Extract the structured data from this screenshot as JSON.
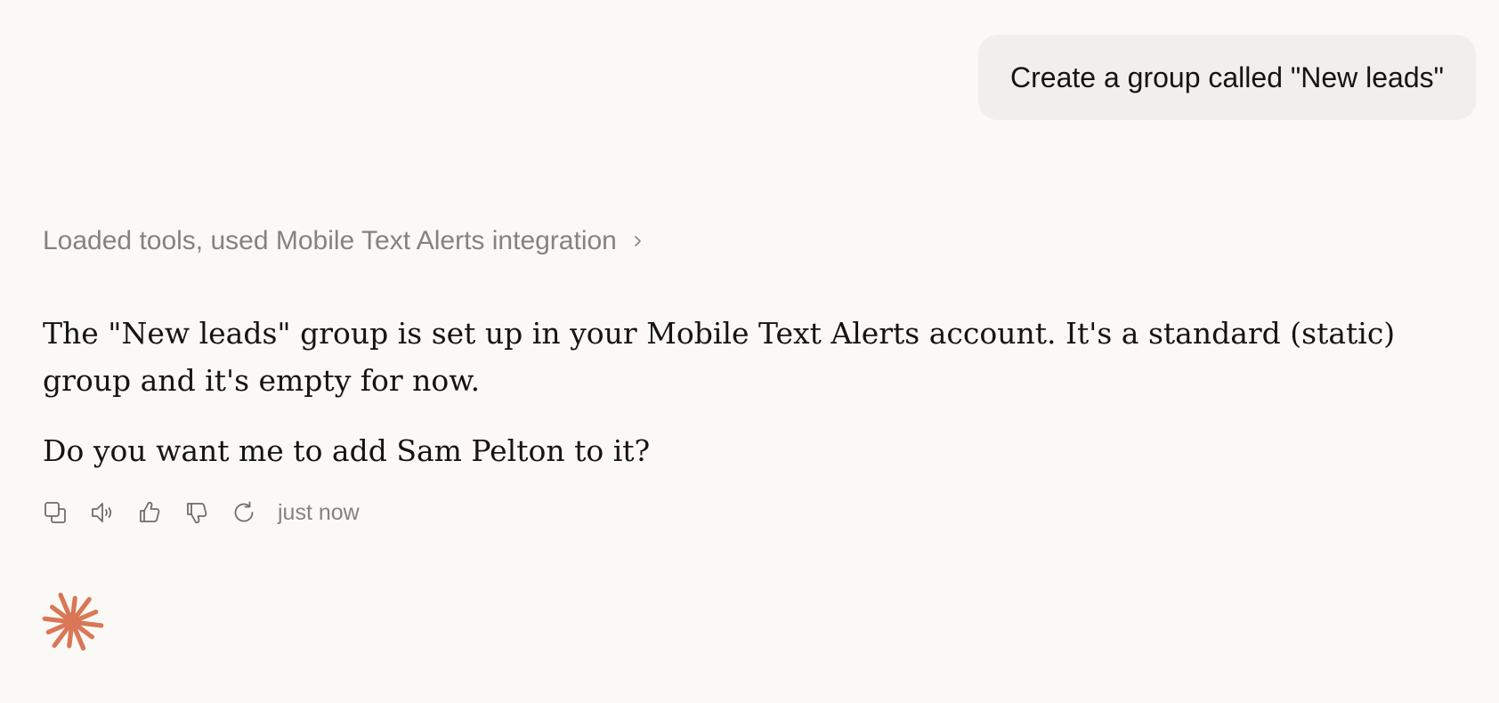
{
  "conversation": {
    "user_message": "Create a group called \"New leads\"",
    "tool_summary": "Loaded tools, used Mobile Text Alerts integration",
    "assistant_paragraphs": [
      "The \"New leads\" group is set up in your Mobile Text Alerts account. It's a standard (static) group and it's empty for now.",
      "Do you want me to add Sam Pelton to it?"
    ],
    "timestamp": "just now"
  },
  "actions": {
    "icons": [
      "copy-icon",
      "speaker-icon",
      "thumbs-up-icon",
      "thumbs-down-icon",
      "retry-icon"
    ]
  },
  "colors": {
    "background": "#faf9f5",
    "user_bubble": "#f0efeb",
    "muted_text": "#85837d",
    "accent_spark": "#d97757"
  }
}
